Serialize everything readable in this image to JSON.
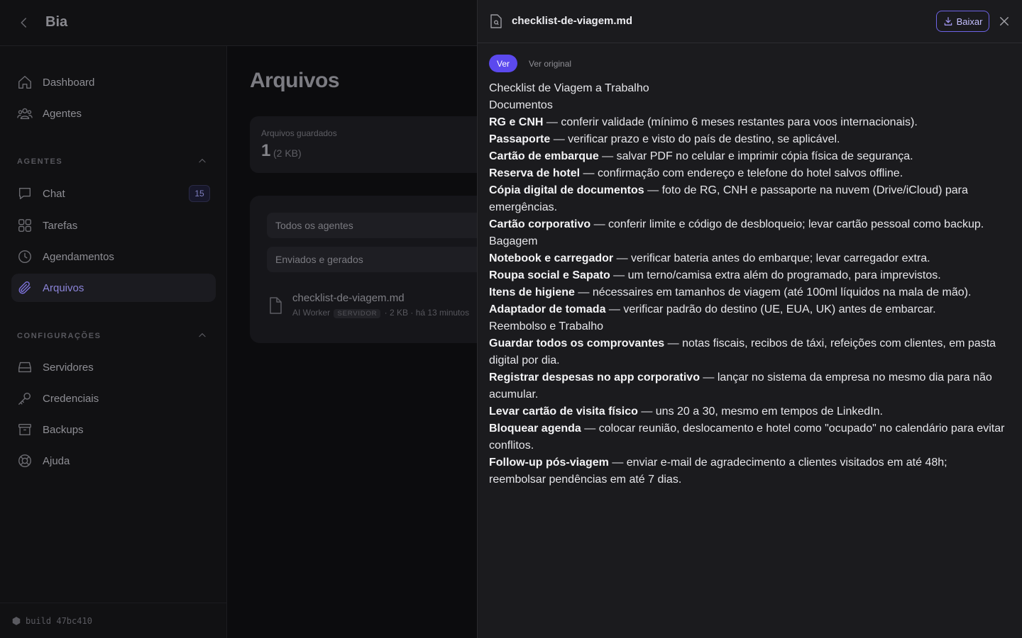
{
  "app": {
    "title": "Bia"
  },
  "sidebar": {
    "top_items": [
      {
        "label": "Dashboard"
      },
      {
        "label": "Agentes"
      }
    ],
    "sections": [
      {
        "label": "AGENTES",
        "items": [
          {
            "label": "Chat",
            "badge": "15"
          },
          {
            "label": "Tarefas"
          },
          {
            "label": "Agendamentos"
          },
          {
            "label": "Arquivos",
            "active": true
          }
        ]
      },
      {
        "label": "CONFIGURAÇÕES",
        "items": [
          {
            "label": "Servidores"
          },
          {
            "label": "Credenciais"
          },
          {
            "label": "Backups"
          },
          {
            "label": "Ajuda"
          }
        ]
      }
    ],
    "build": "build 47bc410"
  },
  "main": {
    "title": "Arquivos",
    "stat": {
      "label": "Arquivos guardados",
      "value": "1",
      "size": "(2 KB)"
    },
    "filters": [
      "Todos os agentes",
      "Enviados e gerados"
    ],
    "file": {
      "name": "checklist-de-viagem.md",
      "agent": "AI Worker",
      "tag": "SERVIDOR",
      "size": "2 KB",
      "time": "há 13 minutos"
    }
  },
  "panel": {
    "filename": "checklist-de-viagem.md",
    "download_label": "Baixar",
    "tab_view": "Ver",
    "tab_original": "Ver original",
    "lines": [
      {
        "bold": "",
        "text": "Checklist de Viagem a Trabalho"
      },
      {
        "bold": "",
        "text": "Documentos"
      },
      {
        "bold": "RG e CNH",
        "text": " — conferir validade (mínimo 6 meses restantes para voos internacionais)."
      },
      {
        "bold": "Passaporte",
        "text": " — verificar prazo e visto do país de destino, se aplicável."
      },
      {
        "bold": "Cartão de embarque",
        "text": " — salvar PDF no celular e imprimir cópia física de segurança."
      },
      {
        "bold": "Reserva de hotel",
        "text": " — confirmação com endereço e telefone do hotel salvos offline."
      },
      {
        "bold": "Cópia digital de documentos",
        "text": " — foto de RG, CNH e passaporte na nuvem (Drive/iCloud) para emergências."
      },
      {
        "bold": "Cartão corporativo",
        "text": " — conferir limite e código de desbloqueio; levar cartão pessoal como backup."
      },
      {
        "bold": "",
        "text": "Bagagem"
      },
      {
        "bold": "Notebook e carregador",
        "text": " — verificar bateria antes do embarque; levar carregador extra."
      },
      {
        "bold": "Roupa social e Sapato",
        "text": " — um terno/camisa extra além do programado, para imprevistos."
      },
      {
        "bold": "Itens de higiene",
        "text": " — nécessaires em tamanhos de viagem (até 100ml líquidos na mala de mão)."
      },
      {
        "bold": "Adaptador de tomada",
        "text": " — verificar padrão do destino (UE, EUA, UK) antes de embarcar."
      },
      {
        "bold": "",
        "text": "Reembolso e Trabalho"
      },
      {
        "bold": "Guardar todos os comprovantes",
        "text": " — notas fiscais, recibos de táxi, refeições com clientes, em pasta digital por dia."
      },
      {
        "bold": "Registrar despesas no app corporativo",
        "text": " — lançar no sistema da empresa no mesmo dia para não acumular."
      },
      {
        "bold": "Levar cartão de visita físico",
        "text": " — uns 20 a 30, mesmo em tempos de LinkedIn."
      },
      {
        "bold": "Bloquear agenda",
        "text": " — colocar reunião, deslocamento e hotel como \"ocupado\" no calendário para evitar conflitos."
      },
      {
        "bold": "Follow-up pós-viagem",
        "text": " — enviar e-mail de agradecimento a clientes visitados em até 48h; reembolsar pendências em até 7 dias."
      }
    ]
  },
  "colors": {
    "accent": "#5b49ee",
    "panel_bg": "#1b1b1e",
    "sidebar_bg": "#111113"
  }
}
